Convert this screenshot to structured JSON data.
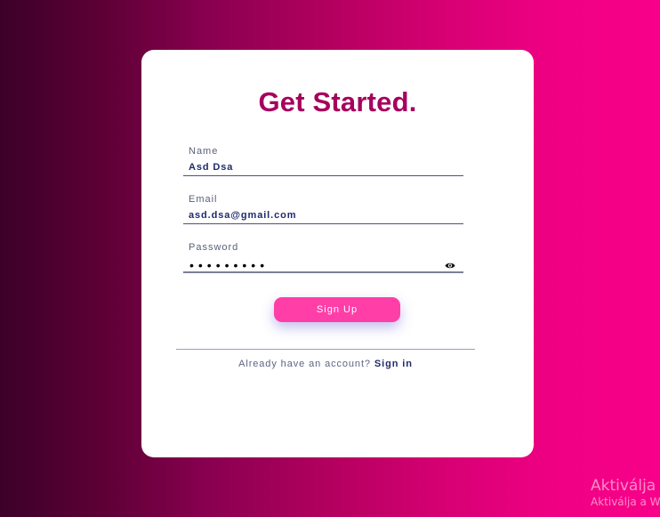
{
  "form": {
    "title": "Get Started.",
    "name": {
      "label": "Name",
      "value": "Asd Dsa"
    },
    "email": {
      "label": "Email",
      "value": "asd.dsa@gmail.com"
    },
    "password": {
      "label": "Password",
      "masked_value": "•••••••••",
      "toggle_icon": "eye-icon"
    },
    "submit_label": "Sign Up",
    "signin_prompt": "Already have an account?",
    "signin_link": "Sign in"
  },
  "watermark": {
    "title": "Aktiválja",
    "subtitle": "Aktiválja a W"
  },
  "colors": {
    "title": "#a6005e",
    "button": "#ff3ea8",
    "link": "#1f2a6b",
    "background_start": "#3c0028",
    "background_end": "#f8008a"
  }
}
